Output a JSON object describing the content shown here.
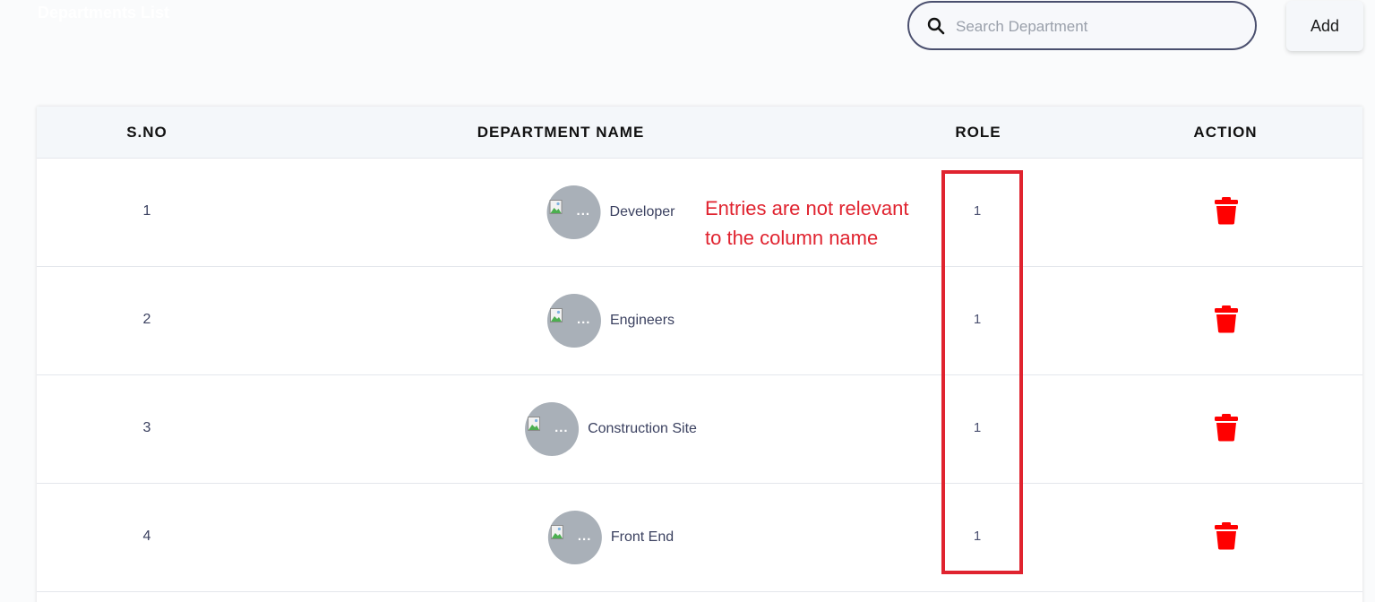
{
  "page": {
    "title": "Departments List"
  },
  "search": {
    "placeholder": "Search Department",
    "value": ""
  },
  "toolbar": {
    "add_label": "Add"
  },
  "table": {
    "columns": [
      "S.NO",
      "DEPARTMENT NAME",
      "ROLE",
      "ACTION"
    ],
    "rows": [
      {
        "sno": "1",
        "name": "Developer",
        "role": "1"
      },
      {
        "sno": "2",
        "name": "Engineers",
        "role": "1"
      },
      {
        "sno": "3",
        "name": "Construction Site",
        "role": "1"
      },
      {
        "sno": "4",
        "name": "Front End",
        "role": "1"
      }
    ],
    "avatar_overflow": "..."
  },
  "annotation": {
    "text_line1": "Entries are not relevant",
    "text_line2": "to the column name",
    "color": "#e0232f"
  },
  "colors": {
    "delete": "#ff0000",
    "header_bg": "#f4f7fa",
    "search_border": "#4a4f6e"
  },
  "icons": {
    "search": "search-icon",
    "delete": "trash-icon",
    "avatar": "broken-image-icon"
  }
}
